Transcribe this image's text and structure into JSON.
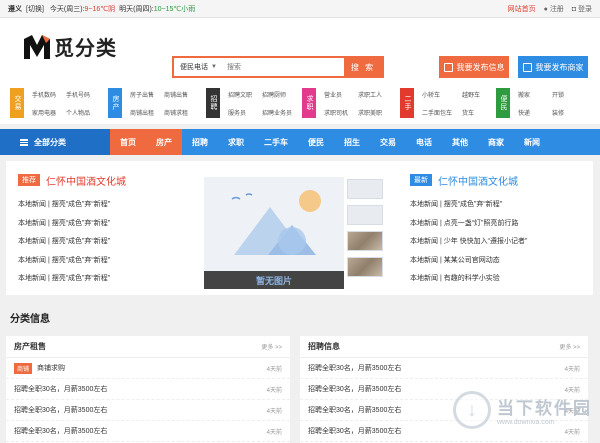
{
  "topbar": {
    "city": "遵义",
    "switch": "[切换]",
    "weather_today": "今天(周三):",
    "weather_today_val": "9~16℃阴",
    "weather_tomorrow": "明天(周四):",
    "weather_tomorrow_val": "10~15℃小雨",
    "home_link": "网站首页",
    "register": "注册",
    "login": "登录"
  },
  "logo": {
    "name": "觅分类"
  },
  "search": {
    "category": "便民电话",
    "placeholder": "搜索",
    "button": "搜 索"
  },
  "header_buttons": {
    "post_info": "我要发布信息",
    "post_shop": "我要发布商家"
  },
  "categories": [
    {
      "tag": "交易",
      "color": "#f0a020",
      "items": [
        "手机数码",
        "手机号码",
        "家用电器",
        "个人物品"
      ]
    },
    {
      "tag": "房产",
      "color": "#2e8ce3",
      "items": [
        "房子出售",
        "商铺出售",
        "商铺出租",
        "商铺求租"
      ]
    },
    {
      "tag": "招聘",
      "color": "#333333",
      "items": [
        "招聘文职",
        "招聘厨师",
        "服务员",
        "招聘业务员"
      ]
    },
    {
      "tag": "求职",
      "color": "#e23b8e",
      "items": [
        "营业员",
        "求职工人",
        "求职司机",
        "求职美职"
      ]
    },
    {
      "tag": "二手",
      "color": "#e23b2e",
      "items": [
        "小轿车",
        "越野车",
        "二手面包车",
        "货车"
      ]
    },
    {
      "tag": "便民",
      "color": "#2e9b3e",
      "items": [
        "搬家",
        "开锁",
        "快递",
        "装修"
      ]
    }
  ],
  "nav": {
    "all_label": "全部分类",
    "items": [
      {
        "label": "首页",
        "active": true
      },
      {
        "label": "房产",
        "active": true
      },
      {
        "label": "招聘",
        "active": false
      },
      {
        "label": "求职",
        "active": false
      },
      {
        "label": "二手车",
        "active": false
      },
      {
        "label": "便民",
        "active": false
      },
      {
        "label": "招生",
        "active": false
      },
      {
        "label": "交易",
        "active": false
      },
      {
        "label": "电话",
        "active": false
      },
      {
        "label": "其他",
        "active": false
      },
      {
        "label": "商家",
        "active": false
      },
      {
        "label": "新闻",
        "active": false
      }
    ]
  },
  "news_left": {
    "badge": "推荐",
    "title": "仁怀中国酒文化城",
    "items": [
      "本地新闻 | 摆亮“成色”弃“新程”",
      "本地新闻 | 摆亮“成色”弃“新程”",
      "本地新闻 | 摆亮“成色”弃“新程”",
      "本地新闻 | 摆亮“成色”弃“新程”",
      "本地新闻 | 摆亮“成色”弃“新程”"
    ]
  },
  "banner": {
    "caption": "暂无图片"
  },
  "news_right": {
    "badge": "最新",
    "title": "仁怀中国酒文化城",
    "items": [
      "本地新闻 | 摆亮“成色”弃“新程”",
      "本地新闻 | 点亮一盏“灯”照亮前行路",
      "本地新闻 | 少年 快快加入“遵报小记者”",
      "本地新闻 | 某某公司官网动态",
      "本地新闻 | 有趣的科学小实验"
    ]
  },
  "section_title": "分类信息",
  "panel_left": {
    "title": "房产租售",
    "more": "更多 >>",
    "rows": [
      {
        "sub": "商铺",
        "text": "商铺求购",
        "time": "4天前"
      },
      {
        "sub": "",
        "text": "招聘全职30名，月薪3500左右",
        "time": "4天前"
      },
      {
        "sub": "",
        "text": "招聘全职30名，月薪3500左右",
        "time": "4天前"
      },
      {
        "sub": "",
        "text": "招聘全职30名，月薪3500左右",
        "time": "4天前"
      }
    ]
  },
  "panel_right": {
    "title": "招聘信息",
    "more": "更多 >>",
    "rows": [
      {
        "sub": "",
        "text": "招聘全职30名，月薪3500左右",
        "time": "4天前"
      },
      {
        "sub": "",
        "text": "招聘全职30名，月薪3500左右",
        "time": "4天前"
      },
      {
        "sub": "",
        "text": "招聘全职30名，月薪3500左右",
        "time": "4天前"
      },
      {
        "sub": "",
        "text": "招聘全职30名，月薪3500左右",
        "time": "4天前"
      }
    ]
  },
  "watermark": {
    "cn": "当下软件园",
    "en": "www.downxia.com",
    "glyph": "↓"
  }
}
